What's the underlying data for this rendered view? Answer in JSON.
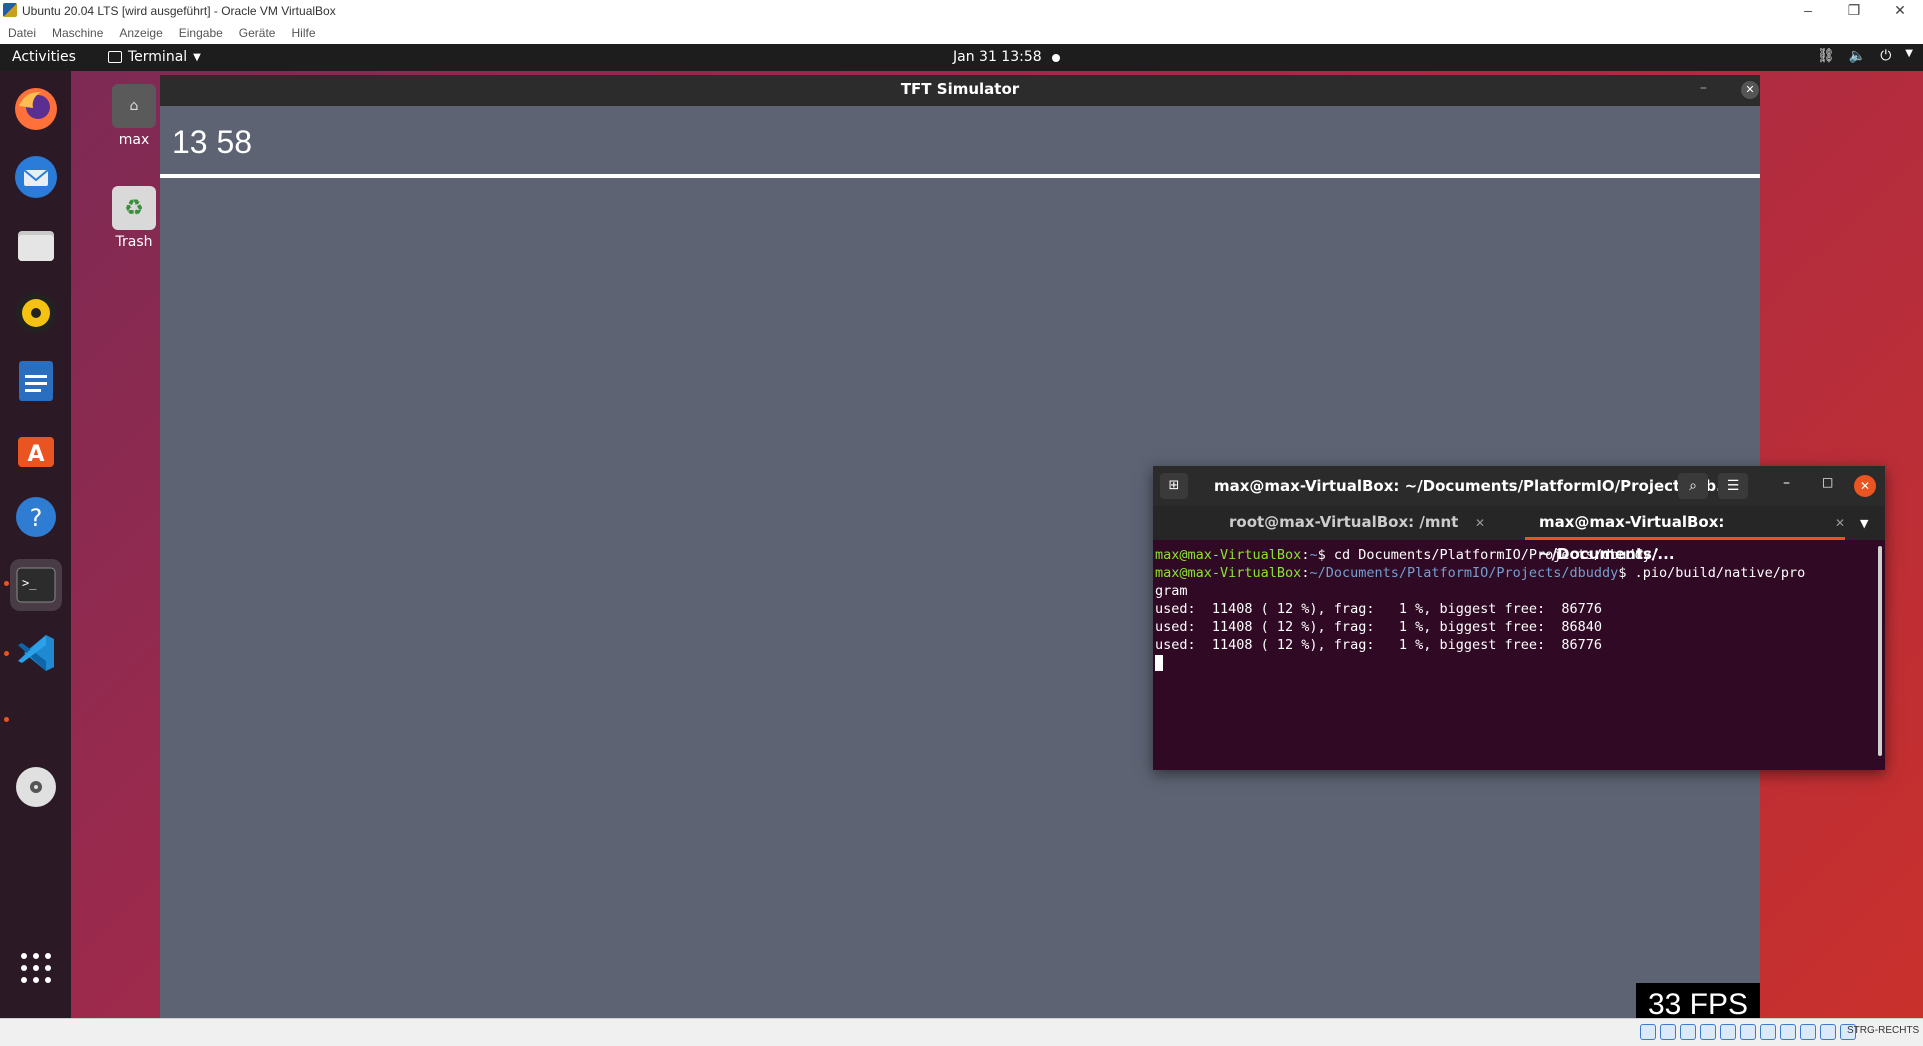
{
  "host": {
    "title": "Ubuntu 20.04 LTS [wird ausgeführt] - Oracle VM VirtualBox",
    "menu": [
      "Datei",
      "Maschine",
      "Anzeige",
      "Eingabe",
      "Geräte",
      "Hilfe"
    ],
    "status_hostkey": "STRG-RECHTS"
  },
  "topbar": {
    "activities": "Activities",
    "app_name": "Terminal",
    "clock": "Jan 31  13:58"
  },
  "dock": {
    "items": [
      "firefox-icon",
      "thunderbird-icon",
      "files-icon",
      "rhythmbox-icon",
      "libreoffice-writer-icon",
      "software-center-icon",
      "help-icon",
      "terminal-icon",
      "vscode-icon",
      "dvd-icon",
      "show-apps-icon"
    ]
  },
  "desktop": {
    "home_label": "max",
    "trash_label": "Trash"
  },
  "tft": {
    "window_title": "TFT Simulator",
    "time": "13 58",
    "fps": "33 FPS"
  },
  "terminal": {
    "title": "max@max-VirtualBox: ~/Documents/PlatformIO/Projects/db...",
    "tabs": [
      {
        "label": "root@max-VirtualBox: /mnt"
      },
      {
        "label": "max@max-VirtualBox: ~/Documents/..."
      }
    ],
    "prompt_user": "max@max-VirtualBox",
    "line1_cmd": "$ cd Documents/PlatformIO/Projects/dbuddy/",
    "line2_path": "~/Documents/PlatformIO/Projects/dbuddy",
    "line2_cmd": "$ .pio/build/native/pro",
    "line3": "gram",
    "output": [
      "used:  11408 ( 12 %), frag:   1 %, biggest free:  86776",
      "used:  11408 ( 12 %), frag:   1 %, biggest free:  86840",
      "used:  11408 ( 12 %), frag:   1 %, biggest free:  86776"
    ]
  },
  "colors": {
    "ubuntu_orange": "#e95420",
    "terminal_bg": "#300a24",
    "tft_bg": "#5d6373"
  }
}
